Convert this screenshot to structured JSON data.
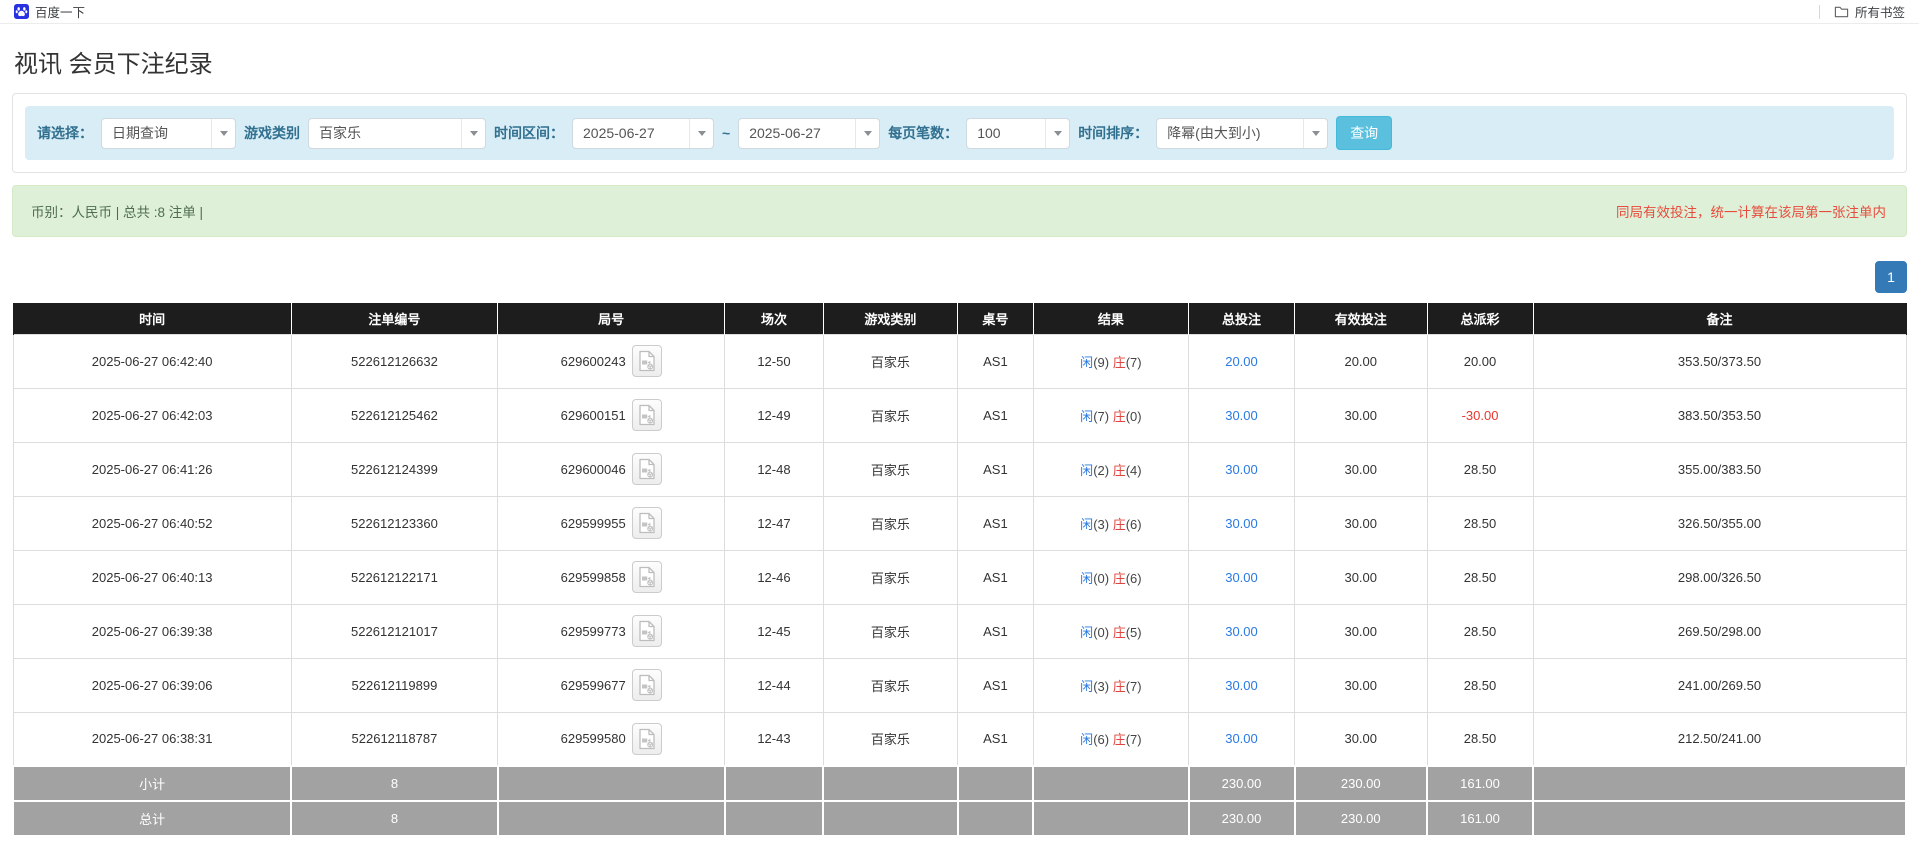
{
  "bookmarks_bar": {
    "bookmark_label": "百度一下",
    "all_bookmarks_label": "所有书签"
  },
  "page": {
    "title": "视讯 会员下注纪录"
  },
  "filters": {
    "query_type": {
      "label": "请选择：",
      "value": "日期查询"
    },
    "game_category": {
      "label": "游戏类别",
      "value": "百家乐"
    },
    "date_range": {
      "label": "时间区间：",
      "from": "2025-06-27",
      "separator": "~",
      "to": "2025-06-27"
    },
    "page_size": {
      "label": "每页笔数：",
      "value": "100"
    },
    "time_sort": {
      "label": "时间排序：",
      "value": "降幂(由大到小)"
    },
    "search_button": "查询"
  },
  "summary": {
    "left_text": "币别：人民币 | 总共 :8 注单 |",
    "right_note": "同局有效投注，统一计算在该局第一张注单内"
  },
  "pagination": {
    "current_page": "1"
  },
  "table": {
    "headers": [
      "时间",
      "注单编号",
      "局号",
      "场次",
      "游戏类别",
      "桌号",
      "结果",
      "总投注",
      "有效投注",
      "总派彩",
      "备注"
    ],
    "rows": [
      {
        "time": "2025-06-27 06:42:40",
        "bet_id": "522612126632",
        "round_id": "629600243",
        "session": "12-50",
        "game": "百家乐",
        "table_no": "AS1",
        "result": {
          "player_label": "闲",
          "player_score": "(9)",
          "banker_label": "庄",
          "banker_score": "(7)"
        },
        "total_bet": "20.00",
        "valid_bet": "20.00",
        "payout": "20.00",
        "remark": "353.50/373.50"
      },
      {
        "time": "2025-06-27 06:42:03",
        "bet_id": "522612125462",
        "round_id": "629600151",
        "session": "12-49",
        "game": "百家乐",
        "table_no": "AS1",
        "result": {
          "player_label": "闲",
          "player_score": "(7)",
          "banker_label": "庄",
          "banker_score": "(0)"
        },
        "total_bet": "30.00",
        "valid_bet": "30.00",
        "payout": "-30.00",
        "remark": "383.50/353.50"
      },
      {
        "time": "2025-06-27 06:41:26",
        "bet_id": "522612124399",
        "round_id": "629600046",
        "session": "12-48",
        "game": "百家乐",
        "table_no": "AS1",
        "result": {
          "player_label": "闲",
          "player_score": "(2)",
          "banker_label": "庄",
          "banker_score": "(4)"
        },
        "total_bet": "30.00",
        "valid_bet": "30.00",
        "payout": "28.50",
        "remark": "355.00/383.50"
      },
      {
        "time": "2025-06-27 06:40:52",
        "bet_id": "522612123360",
        "round_id": "629599955",
        "session": "12-47",
        "game": "百家乐",
        "table_no": "AS1",
        "result": {
          "player_label": "闲",
          "player_score": "(3)",
          "banker_label": "庄",
          "banker_score": "(6)"
        },
        "total_bet": "30.00",
        "valid_bet": "30.00",
        "payout": "28.50",
        "remark": "326.50/355.00"
      },
      {
        "time": "2025-06-27 06:40:13",
        "bet_id": "522612122171",
        "round_id": "629599858",
        "session": "12-46",
        "game": "百家乐",
        "table_no": "AS1",
        "result": {
          "player_label": "闲",
          "player_score": "(0)",
          "banker_label": "庄",
          "banker_score": "(6)"
        },
        "total_bet": "30.00",
        "valid_bet": "30.00",
        "payout": "28.50",
        "remark": "298.00/326.50"
      },
      {
        "time": "2025-06-27 06:39:38",
        "bet_id": "522612121017",
        "round_id": "629599773",
        "session": "12-45",
        "game": "百家乐",
        "table_no": "AS1",
        "result": {
          "player_label": "闲",
          "player_score": "(0)",
          "banker_label": "庄",
          "banker_score": "(5)"
        },
        "total_bet": "30.00",
        "valid_bet": "30.00",
        "payout": "28.50",
        "remark": "269.50/298.00"
      },
      {
        "time": "2025-06-27 06:39:06",
        "bet_id": "522612119899",
        "round_id": "629599677",
        "session": "12-44",
        "game": "百家乐",
        "table_no": "AS1",
        "result": {
          "player_label": "闲",
          "player_score": "(3)",
          "banker_label": "庄",
          "banker_score": "(7)"
        },
        "total_bet": "30.00",
        "valid_bet": "30.00",
        "payout": "28.50",
        "remark": "241.00/269.50"
      },
      {
        "time": "2025-06-27 06:38:31",
        "bet_id": "522612118787",
        "round_id": "629599580",
        "session": "12-43",
        "game": "百家乐",
        "table_no": "AS1",
        "result": {
          "player_label": "闲",
          "player_score": "(6)",
          "banker_label": "庄",
          "banker_score": "(7)"
        },
        "total_bet": "30.00",
        "valid_bet": "30.00",
        "payout": "28.50",
        "remark": "212.50/241.00"
      }
    ],
    "subtotal": {
      "label": "小计",
      "count": "8",
      "total_bet": "230.00",
      "valid_bet": "230.00",
      "payout": "161.00"
    },
    "grand_total": {
      "label": "总计",
      "count": "8",
      "total_bet": "230.00",
      "valid_bet": "230.00",
      "payout": "161.00"
    }
  },
  "colors": {
    "accent_blue": "#337ab7",
    "query_button": "#5bc0de",
    "filter_well_bg": "#d9edf7",
    "filter_label": "#31708f",
    "summary_bg": "#dff0d8",
    "note_red": "#e74c3c",
    "player_blue": "#2a7ae2",
    "banker_red": "#e0443e",
    "negative_red": "#e8362e",
    "header_bg": "#1d1d1d",
    "footer_bg": "#a2a2a2"
  }
}
